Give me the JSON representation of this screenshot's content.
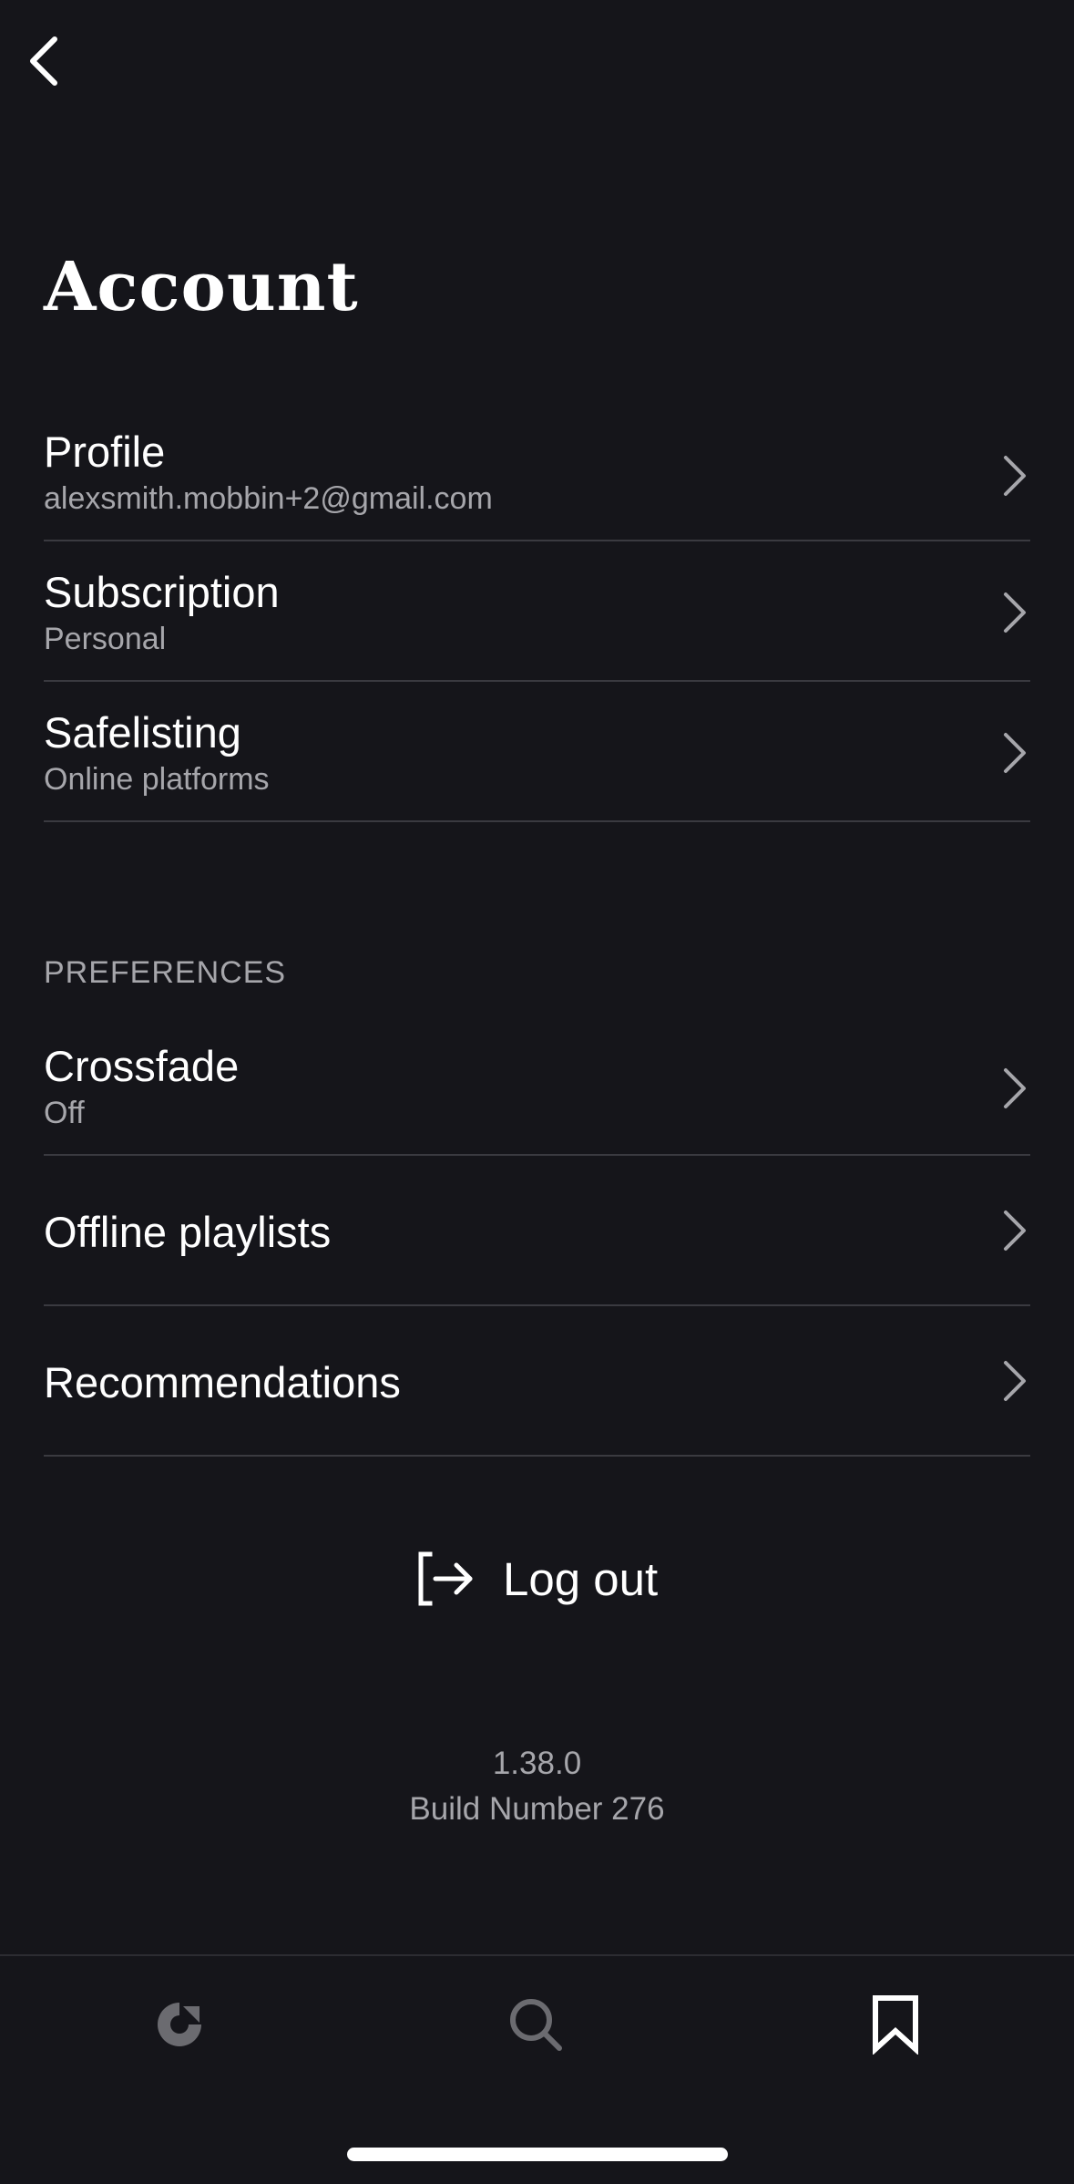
{
  "header": {
    "title": "Account"
  },
  "account_items": [
    {
      "title": "Profile",
      "subtitle": "alexsmith.mobbin+2@gmail.com"
    },
    {
      "title": "Subscription",
      "subtitle": "Personal"
    },
    {
      "title": "Safelisting",
      "subtitle": "Online platforms"
    }
  ],
  "preferences": {
    "header": "PREFERENCES",
    "items": [
      {
        "title": "Crossfade",
        "subtitle": "Off"
      },
      {
        "title": "Offline playlists"
      },
      {
        "title": "Recommendations"
      }
    ]
  },
  "logout": {
    "label": "Log out"
  },
  "app_info": {
    "version": "1.38.0",
    "build": "Build Number 276"
  },
  "tabbar": {
    "tabs": [
      {
        "icon": "discover-icon",
        "active": false
      },
      {
        "icon": "search-icon",
        "active": false
      },
      {
        "icon": "bookmark-icon",
        "active": true
      }
    ]
  },
  "colors": {
    "background": "#15151a",
    "text_primary": "#ffffff",
    "text_secondary": "#a6a6ab",
    "divider": "#3a3a40",
    "icon_inactive": "#6b6b70"
  }
}
